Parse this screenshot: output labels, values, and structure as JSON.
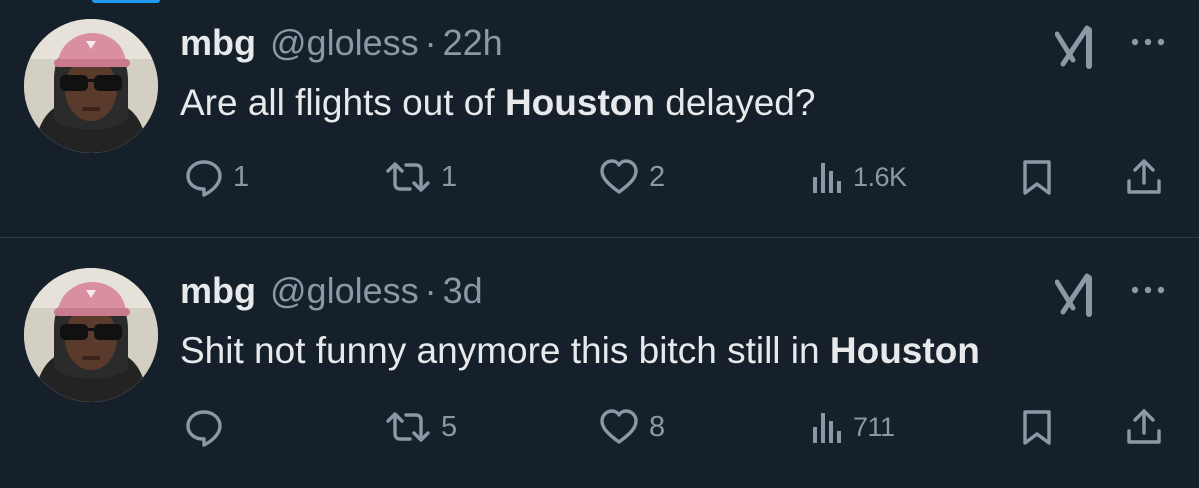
{
  "colors": {
    "background": "#16202b",
    "text": "#e7e9ea",
    "muted": "#8b98a5",
    "accent": "#1d9bf0",
    "divider": "#2f3b47"
  },
  "icons": [
    "reply-icon",
    "retweet-icon",
    "like-icon",
    "views-icon",
    "bookmark-icon",
    "share-icon",
    "grok-icon",
    "more-icon"
  ],
  "tweets": [
    {
      "name": "mbg",
      "handle": "@gloless",
      "separator": "·",
      "time": "22h",
      "text_before": "Are all flights out of ",
      "text_bold": "Houston",
      "text_after": " delayed?",
      "replies": "1",
      "retweets": "1",
      "likes": "2",
      "views": "1.6K"
    },
    {
      "name": "mbg",
      "handle": "@gloless",
      "separator": "·",
      "time": "3d",
      "text_before": "Shit not funny anymore this bitch still in ",
      "text_bold": "Houston",
      "text_after": "",
      "replies": "",
      "retweets": "5",
      "likes": "8",
      "views": "711"
    }
  ]
}
